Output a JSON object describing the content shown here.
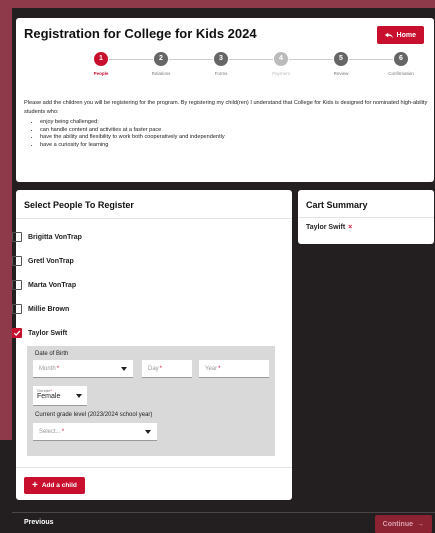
{
  "header": {
    "title": "Registration for College for Kids 2024",
    "home_label": "Home"
  },
  "steps": [
    {
      "num": "1",
      "label": "People",
      "state": "active"
    },
    {
      "num": "2",
      "label": "Relations",
      "state": "normal"
    },
    {
      "num": "3",
      "label": "Forms",
      "state": "normal"
    },
    {
      "num": "4",
      "label": "Payment",
      "state": "disabled"
    },
    {
      "num": "5",
      "label": "Review",
      "state": "normal"
    },
    {
      "num": "6",
      "label": "Confirmation",
      "state": "normal"
    }
  ],
  "intro": {
    "text": "Please add the children you will be registering for the program. By registering my child(ren) I understand that College for Kids is designed for nominated high-ability students who:",
    "bullets": [
      "enjoy being challenged;",
      "can handle content and activities at a faster pace",
      "have the ability and flexibility to work both cooperatively and independently",
      "have a curiosity for learning"
    ]
  },
  "people_section": {
    "title": "Select People To Register",
    "people": [
      {
        "name": "Brigitta VonTrap",
        "checked": false
      },
      {
        "name": "Gretl VonTrap",
        "checked": false
      },
      {
        "name": "Marta VonTrap",
        "checked": false
      },
      {
        "name": "Millie Brown",
        "checked": false
      },
      {
        "name": "Taylor Swift",
        "checked": true
      }
    ],
    "form": {
      "dob_label": "Date of Birth",
      "month_placeholder": "Month",
      "day_placeholder": "Day",
      "year_placeholder": "Year",
      "required_mark": "*",
      "gender_label": "Gender",
      "gender_value": "Female",
      "grade_label": "Current grade level (2023/2024 school year)",
      "grade_placeholder": "Select..."
    },
    "add_child_label": "Add a child"
  },
  "cart": {
    "title": "Cart Summary",
    "items": [
      {
        "name": "Taylor Swift",
        "remove": "×"
      }
    ]
  },
  "footer": {
    "previous_label": "Previous",
    "continue_label": "Continue"
  },
  "colors": {
    "accent": "#c8102e",
    "page_bg": "#231f20",
    "brand_bg": "#8f3a4a",
    "subform_bg": "#d9d9d9"
  }
}
